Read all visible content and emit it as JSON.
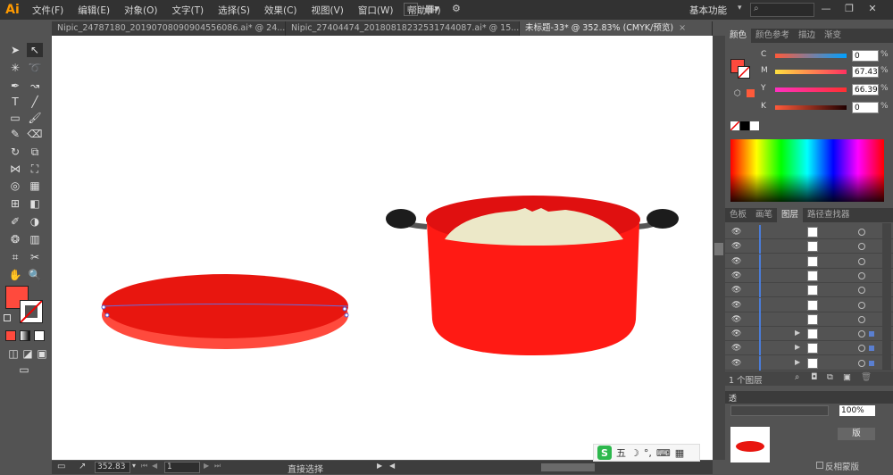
{
  "app": {
    "logo": "Ai"
  },
  "menu": [
    "文件(F)",
    "编辑(E)",
    "对象(O)",
    "文字(T)",
    "选择(S)",
    "效果(C)",
    "视图(V)",
    "窗口(W)",
    "帮助(H)"
  ],
  "menu_icons": {
    "bridge": "Br"
  },
  "workspace": {
    "label": "基本功能",
    "caret": "▾"
  },
  "window_controls": {
    "minimize": "—",
    "restore": "❐",
    "close": "✕"
  },
  "tabs": [
    {
      "label": "Nipic_24787180_20190708090904556086.ai* @ 24...",
      "close": "×"
    },
    {
      "label": "Nipic_27404474_20180818232531744087.ai* @ 15...",
      "close": "×"
    },
    {
      "label": "未标题-33* @ 352.83% (CMYK/预览)",
      "close": "×"
    }
  ],
  "status": {
    "zoom": "352.83",
    "page": "1",
    "tool": "直接选择"
  },
  "colors": {
    "fill": "#ff4a3d",
    "lid_top": "#e8160f",
    "lid_bottom": "#ff4a3d",
    "pot_body": "#ff1a14",
    "pot_rim": "#e01010",
    "rice": "#ece8c8",
    "handle": "#1c1c1c"
  },
  "color_panel": {
    "tabs": [
      "颜色",
      "颜色参考",
      "描边",
      "渐变"
    ],
    "channels": [
      {
        "label": "C",
        "value": "0"
      },
      {
        "label": "M",
        "value": "67.43"
      },
      {
        "label": "Y",
        "value": "66.39"
      },
      {
        "label": "K",
        "value": "0"
      }
    ],
    "unit": "%"
  },
  "layers_panel": {
    "tabs": [
      "色板",
      "画笔",
      "图层",
      "路径查找器"
    ],
    "footer_count": "1 个图层"
  },
  "transparency_panel": {
    "tab": "透",
    "opacity": "100%",
    "make_mask": "版",
    "invert_mask": "反相蒙版"
  },
  "ime": {
    "logo": "S",
    "label": "五"
  }
}
